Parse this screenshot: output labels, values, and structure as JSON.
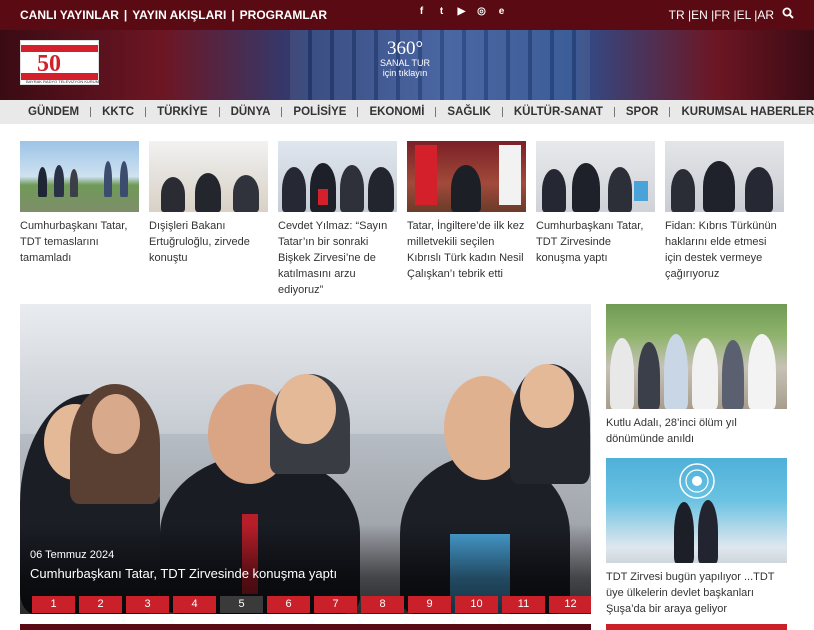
{
  "topbar": {
    "links": [
      "CANLI YAYINLAR",
      "YAYIN AKIŞLARI",
      "PROGRAMLAR"
    ],
    "separator": "|",
    "social": [
      {
        "icon": "facebook-icon",
        "glyph": "f"
      },
      {
        "icon": "twitter-icon",
        "glyph": "t"
      },
      {
        "icon": "youtube-icon",
        "glyph": "▶"
      },
      {
        "icon": "instagram-icon",
        "glyph": "◎"
      },
      {
        "icon": "app-icon",
        "glyph": "e"
      }
    ],
    "languages": "TR |EN |FR |EL |AR"
  },
  "banner": {
    "logo_number": "50",
    "logo_tagline": "BAYRAK RADYO TELEVİZYON KURUMU",
    "tour_number": "360°",
    "tour_line1": "SANAL TUR",
    "tour_line2": "için tıklayın"
  },
  "nav": [
    "GÜNDEM",
    "KKTC",
    "TÜRKİYE",
    "DÜNYA",
    "POLİSİYE",
    "EKONOMİ",
    "SAĞLIK",
    "KÜLTÜR-SANAT",
    "SPOR",
    "KURUMSAL HABERLER"
  ],
  "cards": [
    {
      "title": "Cumhurbaşkanı Tatar, TDT temaslarını tamamladı"
    },
    {
      "title": "Dışişleri Bakanı Ertuğruloğlu, zirvede konuştu"
    },
    {
      "title": "Cevdet Yılmaz: “Sayın Tatar’ın bir sonraki Bişkek Zirvesi’ne de katılmasını arzu ediyoruz”"
    },
    {
      "title": "Tatar, İngiltere’de ilk kez milletvekili seçilen Kıbrıslı Türk kadın Nesil Çalışkan’ı tebrik etti"
    },
    {
      "title": "Cumhurbaşkanı Tatar, TDT Zirvesinde konuşma yaptı"
    },
    {
      "title": "Fidan: Kıbrıs Türkünün haklarını elde etmesi için destek vermeye çağırıyoruz"
    }
  ],
  "slider": {
    "date": "06 Temmuz 2024",
    "caption": "Cumhurbaşkanı Tatar, TDT Zirvesinde konuşma yaptı",
    "pages": [
      "1",
      "2",
      "3",
      "4",
      "5",
      "6",
      "7",
      "8",
      "9",
      "10",
      "11",
      "12"
    ],
    "active_page": "5"
  },
  "side": [
    {
      "title": "Kutlu Adalı, 28’inci ölüm yıl dönümünde anıldı"
    },
    {
      "title": "TDT Zirvesi bugün yapılıyor ...TDT üye ülkelerin devlet başkanları Şuşa’da bir araya geliyor"
    }
  ],
  "colors": {
    "brand_dark": "#5a0a12",
    "brand_red": "#c9202a",
    "nav_bg": "#e9e9e9"
  }
}
